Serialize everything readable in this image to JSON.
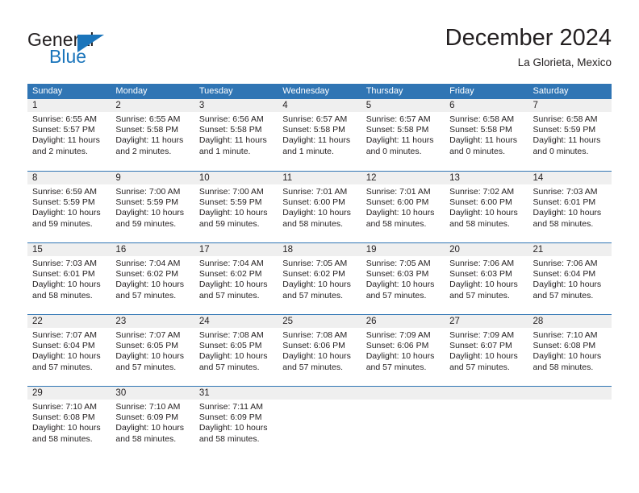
{
  "logo": {
    "general_text": "General",
    "blue_text": "Blue",
    "triangle_color": "#1b75bb"
  },
  "header": {
    "month_title": "December 2024",
    "location": "La Glorieta, Mexico"
  },
  "colors": {
    "header_blue": "#3075b4",
    "row_band_gray": "#efefef",
    "text": "#231f20",
    "logo_blue": "#1b75bb"
  },
  "calendar": {
    "weekdays": [
      "Sunday",
      "Monday",
      "Tuesday",
      "Wednesday",
      "Thursday",
      "Friday",
      "Saturday"
    ],
    "weeks": [
      [
        {
          "day": "1",
          "sunrise": "Sunrise: 6:55 AM",
          "sunset": "Sunset: 5:57 PM",
          "daylight": "Daylight: 11 hours and 2 minutes."
        },
        {
          "day": "2",
          "sunrise": "Sunrise: 6:55 AM",
          "sunset": "Sunset: 5:58 PM",
          "daylight": "Daylight: 11 hours and 2 minutes."
        },
        {
          "day": "3",
          "sunrise": "Sunrise: 6:56 AM",
          "sunset": "Sunset: 5:58 PM",
          "daylight": "Daylight: 11 hours and 1 minute."
        },
        {
          "day": "4",
          "sunrise": "Sunrise: 6:57 AM",
          "sunset": "Sunset: 5:58 PM",
          "daylight": "Daylight: 11 hours and 1 minute."
        },
        {
          "day": "5",
          "sunrise": "Sunrise: 6:57 AM",
          "sunset": "Sunset: 5:58 PM",
          "daylight": "Daylight: 11 hours and 0 minutes."
        },
        {
          "day": "6",
          "sunrise": "Sunrise: 6:58 AM",
          "sunset": "Sunset: 5:58 PM",
          "daylight": "Daylight: 11 hours and 0 minutes."
        },
        {
          "day": "7",
          "sunrise": "Sunrise: 6:58 AM",
          "sunset": "Sunset: 5:59 PM",
          "daylight": "Daylight: 11 hours and 0 minutes."
        }
      ],
      [
        {
          "day": "8",
          "sunrise": "Sunrise: 6:59 AM",
          "sunset": "Sunset: 5:59 PM",
          "daylight": "Daylight: 10 hours and 59 minutes."
        },
        {
          "day": "9",
          "sunrise": "Sunrise: 7:00 AM",
          "sunset": "Sunset: 5:59 PM",
          "daylight": "Daylight: 10 hours and 59 minutes."
        },
        {
          "day": "10",
          "sunrise": "Sunrise: 7:00 AM",
          "sunset": "Sunset: 5:59 PM",
          "daylight": "Daylight: 10 hours and 59 minutes."
        },
        {
          "day": "11",
          "sunrise": "Sunrise: 7:01 AM",
          "sunset": "Sunset: 6:00 PM",
          "daylight": "Daylight: 10 hours and 58 minutes."
        },
        {
          "day": "12",
          "sunrise": "Sunrise: 7:01 AM",
          "sunset": "Sunset: 6:00 PM",
          "daylight": "Daylight: 10 hours and 58 minutes."
        },
        {
          "day": "13",
          "sunrise": "Sunrise: 7:02 AM",
          "sunset": "Sunset: 6:00 PM",
          "daylight": "Daylight: 10 hours and 58 minutes."
        },
        {
          "day": "14",
          "sunrise": "Sunrise: 7:03 AM",
          "sunset": "Sunset: 6:01 PM",
          "daylight": "Daylight: 10 hours and 58 minutes."
        }
      ],
      [
        {
          "day": "15",
          "sunrise": "Sunrise: 7:03 AM",
          "sunset": "Sunset: 6:01 PM",
          "daylight": "Daylight: 10 hours and 58 minutes."
        },
        {
          "day": "16",
          "sunrise": "Sunrise: 7:04 AM",
          "sunset": "Sunset: 6:02 PM",
          "daylight": "Daylight: 10 hours and 57 minutes."
        },
        {
          "day": "17",
          "sunrise": "Sunrise: 7:04 AM",
          "sunset": "Sunset: 6:02 PM",
          "daylight": "Daylight: 10 hours and 57 minutes."
        },
        {
          "day": "18",
          "sunrise": "Sunrise: 7:05 AM",
          "sunset": "Sunset: 6:02 PM",
          "daylight": "Daylight: 10 hours and 57 minutes."
        },
        {
          "day": "19",
          "sunrise": "Sunrise: 7:05 AM",
          "sunset": "Sunset: 6:03 PM",
          "daylight": "Daylight: 10 hours and 57 minutes."
        },
        {
          "day": "20",
          "sunrise": "Sunrise: 7:06 AM",
          "sunset": "Sunset: 6:03 PM",
          "daylight": "Daylight: 10 hours and 57 minutes."
        },
        {
          "day": "21",
          "sunrise": "Sunrise: 7:06 AM",
          "sunset": "Sunset: 6:04 PM",
          "daylight": "Daylight: 10 hours and 57 minutes."
        }
      ],
      [
        {
          "day": "22",
          "sunrise": "Sunrise: 7:07 AM",
          "sunset": "Sunset: 6:04 PM",
          "daylight": "Daylight: 10 hours and 57 minutes."
        },
        {
          "day": "23",
          "sunrise": "Sunrise: 7:07 AM",
          "sunset": "Sunset: 6:05 PM",
          "daylight": "Daylight: 10 hours and 57 minutes."
        },
        {
          "day": "24",
          "sunrise": "Sunrise: 7:08 AM",
          "sunset": "Sunset: 6:05 PM",
          "daylight": "Daylight: 10 hours and 57 minutes."
        },
        {
          "day": "25",
          "sunrise": "Sunrise: 7:08 AM",
          "sunset": "Sunset: 6:06 PM",
          "daylight": "Daylight: 10 hours and 57 minutes."
        },
        {
          "day": "26",
          "sunrise": "Sunrise: 7:09 AM",
          "sunset": "Sunset: 6:06 PM",
          "daylight": "Daylight: 10 hours and 57 minutes."
        },
        {
          "day": "27",
          "sunrise": "Sunrise: 7:09 AM",
          "sunset": "Sunset: 6:07 PM",
          "daylight": "Daylight: 10 hours and 57 minutes."
        },
        {
          "day": "28",
          "sunrise": "Sunrise: 7:10 AM",
          "sunset": "Sunset: 6:08 PM",
          "daylight": "Daylight: 10 hours and 58 minutes."
        }
      ],
      [
        {
          "day": "29",
          "sunrise": "Sunrise: 7:10 AM",
          "sunset": "Sunset: 6:08 PM",
          "daylight": "Daylight: 10 hours and 58 minutes."
        },
        {
          "day": "30",
          "sunrise": "Sunrise: 7:10 AM",
          "sunset": "Sunset: 6:09 PM",
          "daylight": "Daylight: 10 hours and 58 minutes."
        },
        {
          "day": "31",
          "sunrise": "Sunrise: 7:11 AM",
          "sunset": "Sunset: 6:09 PM",
          "daylight": "Daylight: 10 hours and 58 minutes."
        },
        {
          "day": "",
          "sunrise": "",
          "sunset": "",
          "daylight": ""
        },
        {
          "day": "",
          "sunrise": "",
          "sunset": "",
          "daylight": ""
        },
        {
          "day": "",
          "sunrise": "",
          "sunset": "",
          "daylight": ""
        },
        {
          "day": "",
          "sunrise": "",
          "sunset": "",
          "daylight": ""
        }
      ]
    ]
  }
}
